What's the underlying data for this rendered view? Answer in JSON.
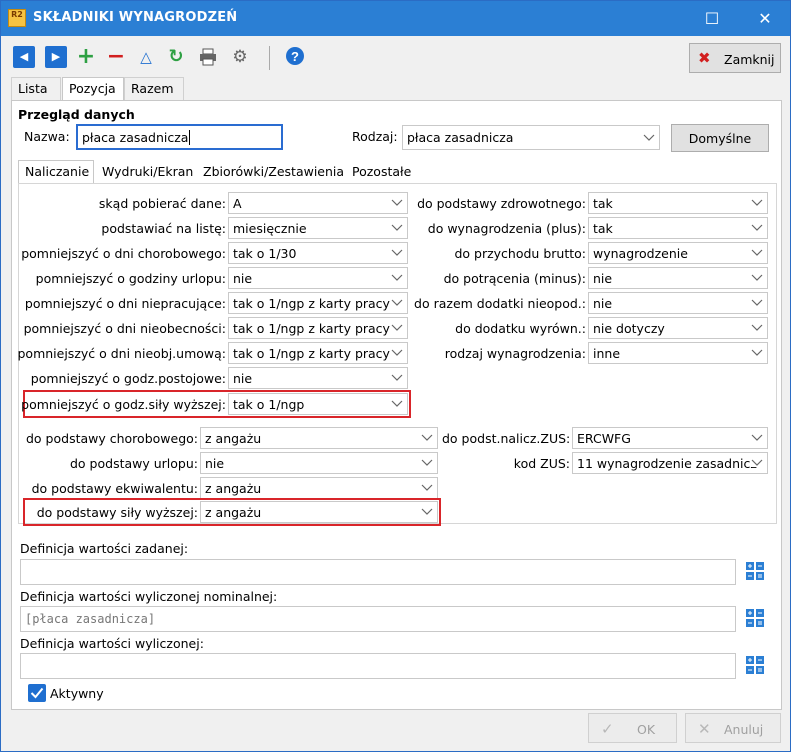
{
  "window": {
    "title": "SKŁADNIKI WYNAGRODZEŃ",
    "app_icon_text": "R2"
  },
  "toolbar": {
    "buttons": [
      {
        "name": "prev-record-button",
        "icon": "arrow-left-icon"
      },
      {
        "name": "next-record-button",
        "icon": "arrow-right-icon"
      },
      {
        "name": "add-button",
        "icon": "plus-icon"
      },
      {
        "name": "delete-button",
        "icon": "minus-icon"
      },
      {
        "name": "edit-button",
        "icon": "triangle-icon"
      },
      {
        "name": "refresh-button",
        "icon": "refresh-icon"
      },
      {
        "name": "print-button",
        "icon": "printer-icon"
      },
      {
        "name": "settings-button",
        "icon": "gear-icon"
      },
      {
        "name": "help-button",
        "icon": "help-icon"
      }
    ],
    "close_label": "Zamknij"
  },
  "main_tabs": [
    "Lista",
    "Pozycja",
    "Razem"
  ],
  "main_tab_active": 1,
  "section_title": "Przegląd danych",
  "nazwa": {
    "label": "Nazwa:",
    "value": "płaca zasadnicza"
  },
  "rodzaj": {
    "label": "Rodzaj:",
    "value": "płaca zasadnicza"
  },
  "default_button": "Domyślne",
  "sub_tabs": [
    "Naliczanie",
    "Wydruki/Ekran",
    "Zbiorówki/Zestawienia",
    "Pozostałe"
  ],
  "sub_tab_active": 0,
  "left_fields": [
    {
      "label": "skąd pobierać dane:",
      "value": "A"
    },
    {
      "label": "podstawiać na listę:",
      "value": "miesięcznie"
    },
    {
      "label": "pomniejszyć o dni chorobowego:",
      "value": "tak o 1/30"
    },
    {
      "label": "pomniejszyć o godziny urlopu:",
      "value": "nie"
    },
    {
      "label": "pomniejszyć o dni niepracujące:",
      "value": "tak o 1/ngp z karty pracy"
    },
    {
      "label": "pomniejszyć o dni nieobecności:",
      "value": "tak o 1/ngp z karty pracy"
    },
    {
      "label": "pomniejszyć o dni nieobj.umową:",
      "value": "tak o 1/ngp z karty pracy"
    },
    {
      "label": "pomniejszyć o godz.postojowe:",
      "value": "nie"
    },
    {
      "label": "pomniejszyć o godz.siły wyższej:",
      "value": "tak o 1/ngp"
    }
  ],
  "right_fields": [
    {
      "label": "do podstawy zdrowotnego:",
      "value": "tak"
    },
    {
      "label": "do wynagrodzenia (plus):",
      "value": "tak"
    },
    {
      "label": "do przychodu brutto:",
      "value": "wynagrodzenie"
    },
    {
      "label": "do potrącenia (minus):",
      "value": "nie"
    },
    {
      "label": "do razem dodatki nieopod.:",
      "value": "nie"
    },
    {
      "label": "do dodatku wyrówn.:",
      "value": "nie dotyczy"
    },
    {
      "label": "rodzaj wynagrodzenia:",
      "value": "inne"
    }
  ],
  "lower_left_fields": [
    {
      "label": "do podstawy chorobowego:",
      "value": "z angażu"
    },
    {
      "label": "do podstawy urlopu:",
      "value": "nie"
    },
    {
      "label": "do podstawy ekwiwalentu:",
      "value": "z angażu"
    },
    {
      "label": "do podstawy siły wyższej:",
      "value": "z angażu"
    }
  ],
  "lower_right_fields": [
    {
      "label": "do podst.nalicz.ZUS:",
      "value": "ERCWFG"
    },
    {
      "label": "kod ZUS:",
      "value": "11 wynagrodzenie zasadnicz"
    }
  ],
  "definitions": [
    {
      "label": "Definicja wartości zadanej:",
      "value": ""
    },
    {
      "label": "Definicja wartości wyliczonej nominalnej:",
      "value": "[płaca zasadnicza]"
    },
    {
      "label": "Definicja wartości wyliczonej:",
      "value": ""
    }
  ],
  "active_checkbox": {
    "label": "Aktywny",
    "checked": true
  },
  "footer": {
    "ok_label": "OK",
    "cancel_label": "Anuluj"
  },
  "colors": {
    "titlebar": "#2b7fd4",
    "highlight_box": "#d9252a",
    "accent_blue": "#1f6fd0"
  }
}
